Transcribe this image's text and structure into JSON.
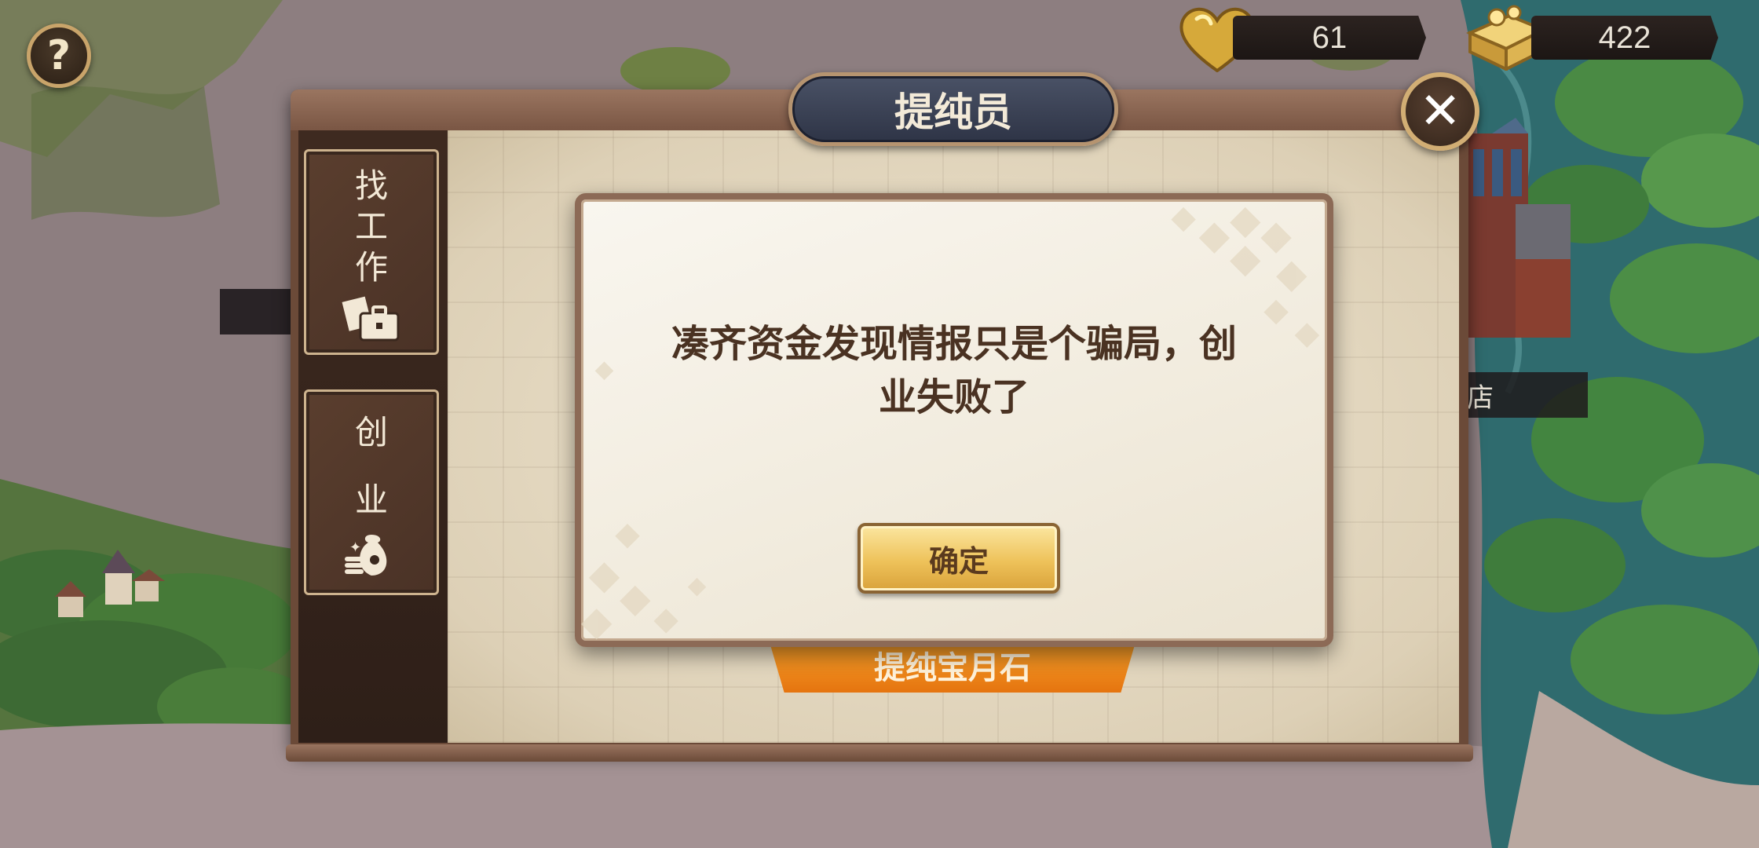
{
  "hud": {
    "help_label": "?",
    "hearts": "61",
    "gold": "422"
  },
  "panel": {
    "title": "提纯员",
    "close_label": "✕",
    "tabs": [
      {
        "label": [
          "找",
          "工",
          "作"
        ],
        "icon": "briefcase-icon"
      },
      {
        "label": [
          "创",
          "业"
        ],
        "icon": "money-bag-icon"
      }
    ],
    "purify_button": "提纯宝月石"
  },
  "dialog": {
    "message_line1": "凑齐资金发现情报只是个骗局，创",
    "message_line2": "业失败了",
    "confirm_label": "确定"
  },
  "map": {
    "shop_label": "店"
  },
  "colors": {
    "dialog_bg": "#f1ebdd",
    "dialog_border": "#8c6a56",
    "confirm_gold": "#eec25a",
    "title_plate": "#3a4156",
    "purify_orange": "#e5740f"
  }
}
